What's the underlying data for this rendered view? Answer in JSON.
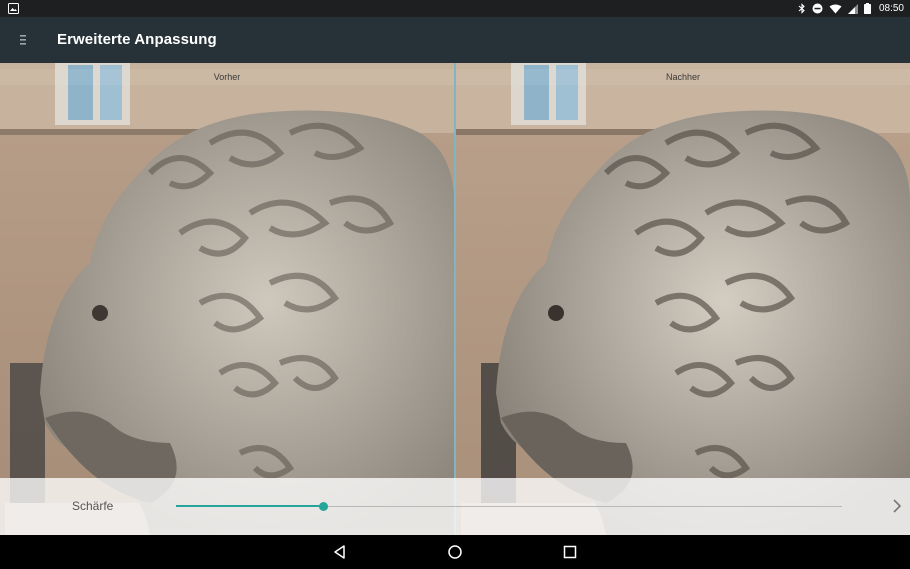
{
  "status_bar": {
    "time": "08:50",
    "icons": [
      "image-icon",
      "bluetooth-icon",
      "do-not-disturb-icon",
      "wifi-icon",
      "signal-icon",
      "battery-icon"
    ]
  },
  "app_bar": {
    "title": "Erweiterte Anpassung",
    "menu_icon": "menu-icon"
  },
  "compare": {
    "before_label": "Vorher",
    "after_label": "Nachher"
  },
  "adjustment": {
    "label": "Schärfe",
    "slider_value": 0.22,
    "accent_color": "#26a69a",
    "next_icon": "chevron-right-icon"
  },
  "nav_bar": {
    "icons": [
      "back-icon",
      "home-icon",
      "recents-icon"
    ]
  },
  "colors": {
    "app_bar": "#263238",
    "status_bar": "#1d1f21",
    "divider": "#7fb6c4"
  }
}
